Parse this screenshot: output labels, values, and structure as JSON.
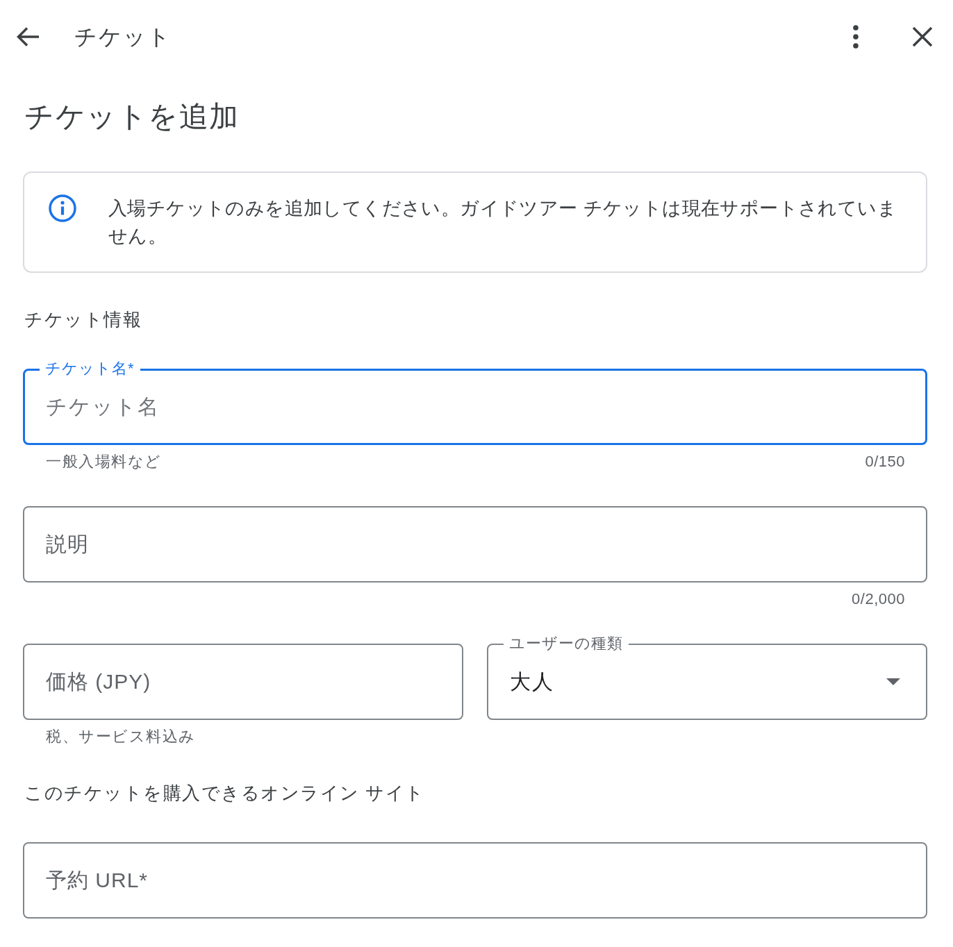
{
  "top_bar": {
    "title": "チケット"
  },
  "heading": "チケットを追加",
  "notice": {
    "text": "入場チケットのみを追加してください。ガイドツアー チケットは現在サポートされていません。"
  },
  "sections": [
    {
      "title": "チケット情報",
      "rows": [
        {
          "fields": [
            {
              "kind": "text",
              "label": "チケット名*",
              "placeholder": "チケット名",
              "focused": true,
              "helper": "一般入場料など",
              "counter": "0/150"
            }
          ]
        },
        {
          "fields": [
            {
              "kind": "text",
              "label": "説明",
              "focused": false,
              "counter": "0/2,000"
            }
          ]
        },
        {
          "fields": [
            {
              "kind": "text",
              "label": "価格 (JPY)",
              "focused": false,
              "helper": "税、サービス料込み"
            },
            {
              "kind": "select",
              "label": "ユーザーの種類",
              "value": "大人",
              "focused": false
            }
          ]
        }
      ]
    },
    {
      "title": "このチケットを購入できるオンライン サイト",
      "rows": [
        {
          "fields": [
            {
              "kind": "text",
              "label": "予約 URL*",
              "focused": false
            }
          ]
        }
      ]
    }
  ]
}
